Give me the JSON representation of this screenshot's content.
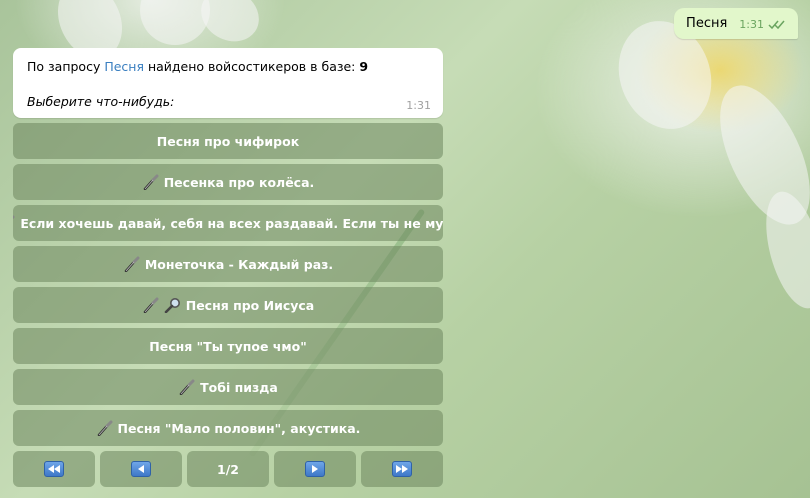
{
  "outgoing": {
    "text": "Песня",
    "time": "1:31"
  },
  "incoming": {
    "prefix": "По запросу ",
    "query": "Песня",
    "middle": " найдено войсостикеров в базе: ",
    "count": "9",
    "prompt": "Выберите что-нибудь:",
    "time": "1:31"
  },
  "keyboard": {
    "buttons": [
      {
        "label": "Песня про чифирок",
        "icons": []
      },
      {
        "label": "Песенка про колёса.",
        "icons": [
          "microphone-icon"
        ]
      },
      {
        "label": "Если хочешь давай, себя на всех раздавай. Если ты не му...",
        "icons": [
          "microphone-icon"
        ]
      },
      {
        "label": "Монеточка - Каждый раз.",
        "icons": [
          "microphone-icon"
        ]
      },
      {
        "label": "Песня про Иисуса",
        "icons": [
          "microphone-icon",
          "magnifier-icon"
        ]
      },
      {
        "label": "Песня \"Ты тупое чмо\"",
        "icons": []
      },
      {
        "label": "Тобі пизда",
        "icons": [
          "microphone-icon"
        ]
      },
      {
        "label": "Песня \"Мало половин\", акустика.",
        "icons": [
          "microphone-icon"
        ]
      }
    ],
    "nav": {
      "first": "⏪",
      "prev": "◀",
      "page": "1/2",
      "next": "▶",
      "last": "⏩"
    }
  },
  "colors": {
    "outgoing_bubble": "#e2f7cb",
    "link": "#3a7fc0",
    "keyboard_button": "#6e875f"
  }
}
